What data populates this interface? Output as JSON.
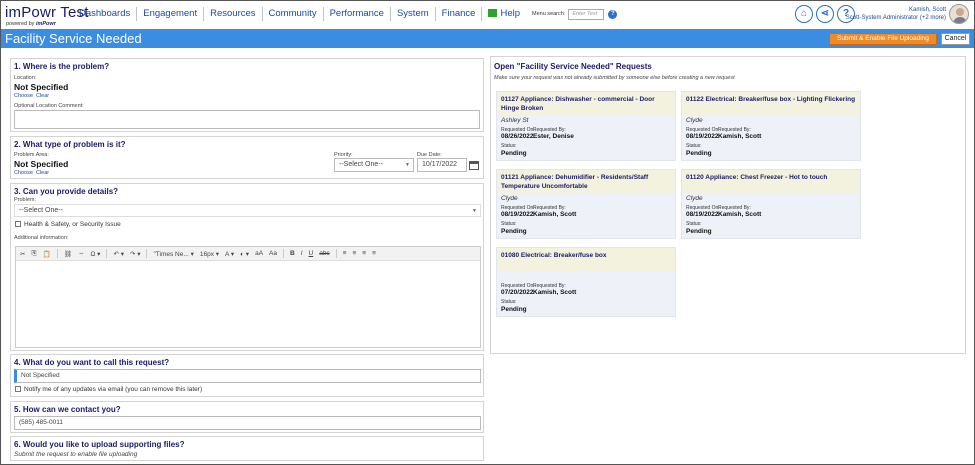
{
  "app": {
    "title": "imPowr Test",
    "powered_prefix": "powered by",
    "powered_brand": "imPowr"
  },
  "nav": {
    "items": [
      "Dashboards",
      "Engagement",
      "Resources",
      "Community",
      "Performance",
      "System",
      "Finance"
    ],
    "help_label": "Help",
    "menu_search_label": "Menu search:",
    "menu_search_placeholder": "Enter Text",
    "help_glyph": "?"
  },
  "user": {
    "name": "Kamish, Scott",
    "role": "Scott-System Administrator (+2 more)"
  },
  "header_icons": [
    {
      "name": "home-icon",
      "glyph": "⌂"
    },
    {
      "name": "share-icon",
      "glyph": "⋖"
    },
    {
      "name": "help-icon",
      "glyph": "?"
    }
  ],
  "titlebar": {
    "title": "Facility Service Needed",
    "submit_label": "Submit & Enable File Uploading",
    "cancel_label": "Cancel"
  },
  "section1": {
    "heading": "1. Where is the problem?",
    "location_label": "Location:",
    "location_value": "Not Specified",
    "choose": "Choose",
    "clear": "Clear",
    "comment_label": "Optional Location Comment:",
    "comment_value": ""
  },
  "section2": {
    "heading": "2. What type of problem is it?",
    "area_label": "Problem Area:",
    "area_value": "Not Specified",
    "choose": "Choose",
    "clear": "Clear",
    "priority_label": "Priority:",
    "priority_value": "--Select One--",
    "due_label": "Due Date:",
    "due_value": "10/17/2022"
  },
  "section3": {
    "heading": "3. Can you provide details?",
    "problem_label": "Problem:",
    "problem_value": "--Select One--",
    "health_label": "Health & Safety, or Security Issue",
    "info_label": "Additional information:",
    "toolbar": [
      "✂",
      "⎘",
      "📋",
      "⛓",
      "⇔",
      "Ω ▾",
      "↶ ▾",
      "↷ ▾",
      "\"Times Ne... ▾",
      "16px ▾",
      "A ▾",
      "◐ ▾",
      "aA",
      "Aa",
      "B",
      "I",
      "U",
      "abc",
      "≡",
      "≡",
      "≡",
      "≡"
    ]
  },
  "section4": {
    "heading": "4. What do you want to call this request?",
    "name_value": "Not Specified",
    "notify_label": "Notify me of any updates via email (you can remove this later)"
  },
  "section5": {
    "heading": "5. How can we contact you?",
    "phone_value": "(585) 485-0011"
  },
  "section6": {
    "heading": "6. Would you like to upload supporting files?",
    "note": "Submit the request to enable file uploading"
  },
  "open_requests": {
    "heading": "Open \"Facility Service Needed\" Requests",
    "subheading": "Make sure your request was not already submitted by someone else before creating a new request",
    "requested_on_label": "Requested On:",
    "requested_by_label": "Requested By:",
    "status_label": "Status:",
    "cards": [
      {
        "title": "01127 Appliance: Dishwasher - commercial - Door Hinge Broken",
        "location": "Ashley St",
        "date": "08/26/2022",
        "by": "Ester, Denise",
        "status": "Pending"
      },
      {
        "title": "01122 Electrical: Breaker/fuse box - Lighting Flickering",
        "location": "Clyde",
        "date": "08/19/2022",
        "by": "Kamish, Scott",
        "status": "Pending"
      },
      {
        "title": "01121 Appliance: Dehumidifier - Residents/Staff Temperature Uncomfortable",
        "location": "Clyde",
        "date": "08/19/2022",
        "by": "Kamish, Scott",
        "status": "Pending"
      },
      {
        "title": "01120 Appliance: Chest Freezer - Hot to touch",
        "location": "Clyde",
        "date": "08/19/2022",
        "by": "Kamish, Scott",
        "status": "Pending"
      },
      {
        "title": "01080 Electrical: Breaker/fuse box",
        "location": "",
        "date": "07/20/2022",
        "by": "Kamish, Scott",
        "status": "Pending"
      }
    ]
  },
  "colors": {
    "titlebar": "#3a8de0",
    "submit": "#f08a24",
    "heading": "#1a1a6e",
    "card_header": "#f2f2de",
    "card_body": "#eef1f8"
  }
}
